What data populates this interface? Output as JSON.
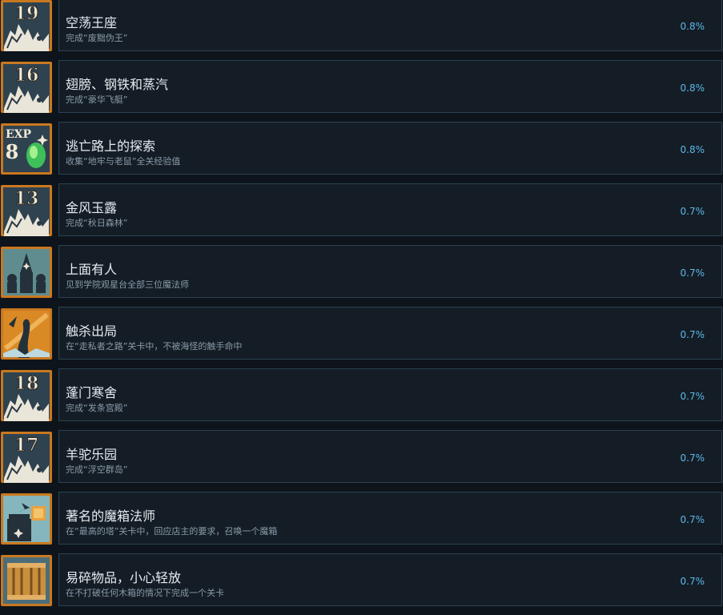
{
  "achievements": [
    {
      "title": "空荡王座",
      "desc": "完成“废黜伪王”",
      "percent": "0.8%",
      "icon": "level-19-icon",
      "num": "19",
      "kind": "level"
    },
    {
      "title": "翅膀、钢铁和蒸汽",
      "desc": "完成“豪华飞艇”",
      "percent": "0.8%",
      "icon": "level-16-icon",
      "num": "16",
      "kind": "level"
    },
    {
      "title": "逃亡路上的探索",
      "desc": "收集“地牢与老鼠”全关经验值",
      "percent": "0.8%",
      "icon": "exp-8-gem-icon",
      "num": "8",
      "kind": "exp"
    },
    {
      "title": "金风玉露",
      "desc": "完成“秋日森林”",
      "percent": "0.7%",
      "icon": "level-13-icon",
      "num": "13",
      "kind": "level"
    },
    {
      "title": "上面有人",
      "desc": "见到学院观星台全部三位魔法师",
      "percent": "0.7%",
      "icon": "three-wizards-icon",
      "num": "",
      "kind": "wizards"
    },
    {
      "title": "触杀出局",
      "desc": "在“走私者之路”关卡中，不被海怪的触手命中",
      "percent": "0.7%",
      "icon": "tentacle-icon",
      "num": "",
      "kind": "tentacle"
    },
    {
      "title": "蓬门寒舍",
      "desc": "完成“发条宫殿”",
      "percent": "0.7%",
      "icon": "level-18-icon",
      "num": "18",
      "kind": "level"
    },
    {
      "title": "羊驼乐园",
      "desc": "完成“浮空群岛”",
      "percent": "0.7%",
      "icon": "level-17-icon",
      "num": "17",
      "kind": "level"
    },
    {
      "title": "著名的魔箱法师",
      "desc": "在“最高的塔”关卡中，回应店主的要求，召唤一个魔箱",
      "percent": "0.7%",
      "icon": "magic-box-wizard-icon",
      "num": "",
      "kind": "box"
    },
    {
      "title": "易碎物品，小心轻放",
      "desc": "在不打破任何木箱的情况下完成一个关卡",
      "percent": "0.7%",
      "icon": "wooden-crate-icon",
      "num": "",
      "kind": "crate"
    }
  ]
}
